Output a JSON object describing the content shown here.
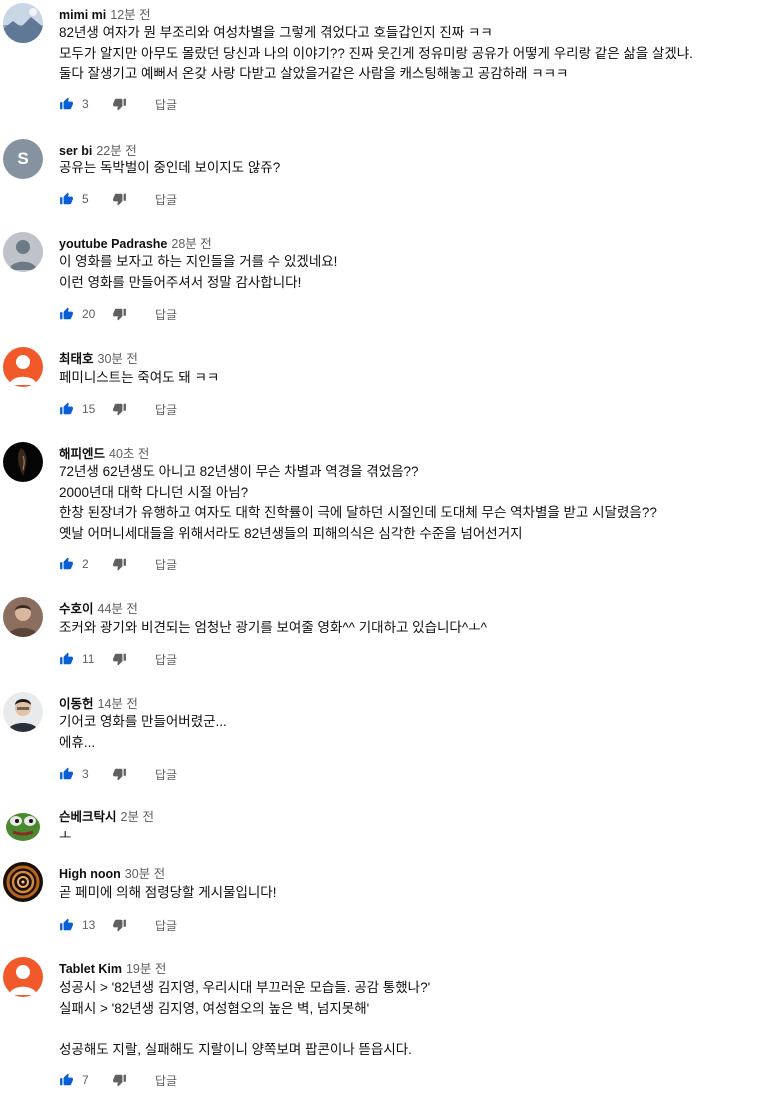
{
  "comments": [
    {
      "author": "mimi mi",
      "time": "12분 전",
      "lines": [
        "82년생 여자가 뭔 부조리와 여성차별을 그렇게 겪었다고 호들갑인지 진짜 ㅋㅋ",
        "모두가 알지만 아무도 몰랐던 당신과 나의 이야기?? 진짜 웃긴게 정유미랑 공유가 어떻게 우리랑 같은 삶을 살겠냐.",
        "둘다 잘생기고 예뻐서 온갖 사랑 다받고 살았을거같은 사람을 캐스팅해놓고 공감하래 ㅋㅋㅋ"
      ],
      "likes": "3",
      "reply": "답글",
      "avatar": "landscape"
    },
    {
      "author": "ser bi",
      "time": "22분 전",
      "lines": [
        "공유는 독박벌이 중인데 보이지도 않쥬?"
      ],
      "likes": "5",
      "reply": "답글",
      "avatar": "letter",
      "letter": "S"
    },
    {
      "author": "youtube Padrashe",
      "time": "28분 전",
      "lines": [
        "이 영화를 보자고 하는 지인들을 거를 수 있겠네요!",
        "이런 영화를 만들어주셔서 정말 감사합니다!"
      ],
      "likes": "20",
      "reply": "답글",
      "avatar": "default"
    },
    {
      "author": "최태호",
      "time": "30분 전",
      "lines": [
        "페미니스트는 죽여도 돼 ㅋㅋ"
      ],
      "likes": "15",
      "reply": "답글",
      "avatar": "orange"
    },
    {
      "author": "해피엔드",
      "time": "40초 전",
      "lines": [
        "72년생 62년생도 아니고 82년생이 무슨 차별과 역경을 겪었음??",
        "2000년대 대학 다니던 시절 아님?",
        "한창 된장녀가 유행하고 여자도 대학 진학률이 극에 달하던 시절인데 도대체 무슨 역차별을 받고 시달렸음??",
        "옛날 어머니세대들을 위해서라도 82년생들의 피해의식은 심각한 수준을 넘어선거지"
      ],
      "likes": "2",
      "reply": "답글",
      "avatar": "dark"
    },
    {
      "author": "수호이",
      "time": "44분 전",
      "lines": [
        "조커와 광기와 비견되는  엄청난 광기를 보여줄 영화^^ 기대하고 있습니다^ㅗ^"
      ],
      "likes": "11",
      "reply": "답글",
      "avatar": "photo"
    },
    {
      "author": "이동헌",
      "time": "14분 전",
      "lines": [
        "기어코 영화를 만들어버렸군...",
        "에휴..."
      ],
      "likes": "3",
      "reply": "답글",
      "avatar": "man"
    },
    {
      "author": "슨베크탁시",
      "time": "2분 전",
      "lines": [
        "ㅗ"
      ],
      "likes": "",
      "reply": "",
      "avatar": "frog"
    },
    {
      "author": "High noon",
      "time": "30분 전",
      "lines": [
        "곧 페미에 의해 점령당할 게시물입니다!"
      ],
      "likes": "13",
      "reply": "답글",
      "avatar": "spiral"
    },
    {
      "author": "Tablet Kim",
      "time": "19분 전",
      "lines": [
        "성공시 > '82년생 김지영, 우리시대 부끄러운 모습들. 공감 통했나?'",
        "실패시 > '82년생 김지영, 여성혐오의 높은 벽, 넘지못해'",
        "",
        "성공해도 지랄, 실패해도 지랄이니 양쪽보며 팝콘이나 뜯읍시다."
      ],
      "likes": "7",
      "reply": "답글",
      "avatar": "orange"
    }
  ],
  "colors": {
    "text": "#0f0f0f",
    "meta": "#606060",
    "icon": "#606060"
  }
}
